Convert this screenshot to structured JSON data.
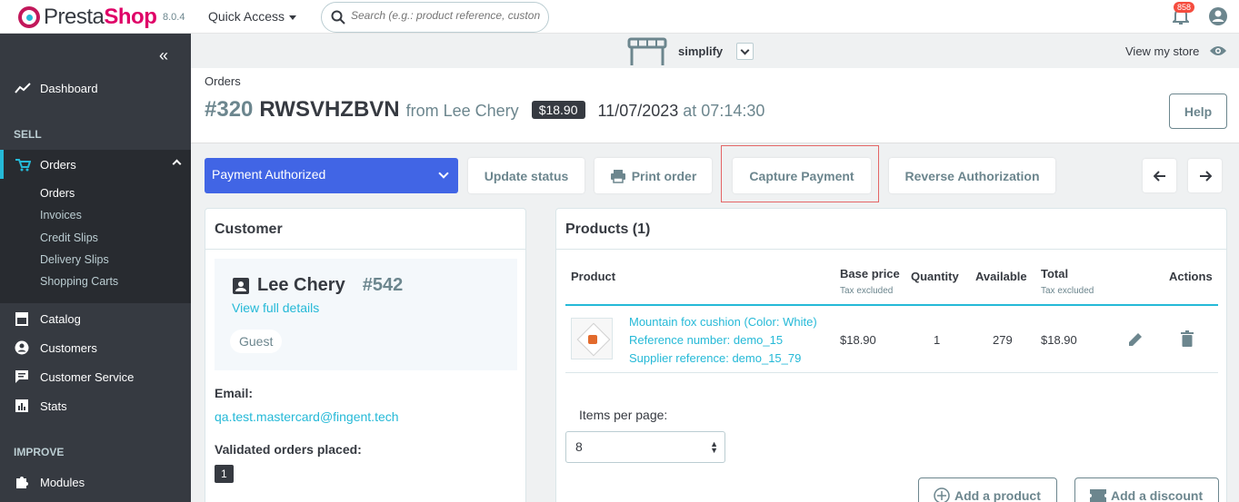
{
  "topbar": {
    "brand_pre": "Presta",
    "brand_shop": "Shop",
    "version": "8.0.4",
    "quick_access": "Quick Access",
    "search_placeholder": "Search (e.g.: product reference, custon",
    "notifications_count": "858"
  },
  "sidebar": {
    "items": [
      {
        "label": "Dashboard",
        "icon": "trending-up-icon"
      },
      {
        "label": "Orders",
        "icon": "cart-icon"
      },
      {
        "label": "Catalog",
        "icon": "store-icon"
      },
      {
        "label": "Customers",
        "icon": "user-circle-icon"
      },
      {
        "label": "Customer Service",
        "icon": "chat-icon"
      },
      {
        "label": "Stats",
        "icon": "bar-chart-icon"
      },
      {
        "label": "Modules",
        "icon": "puzzle-icon"
      }
    ],
    "sections": {
      "sell": "SELL",
      "improve": "IMPROVE"
    },
    "order_subitems": [
      "Orders",
      "Invoices",
      "Credit Slips",
      "Delivery Slips",
      "Shopping Carts"
    ]
  },
  "storebar": {
    "store_name": "simplify",
    "view_store": "View my store"
  },
  "header": {
    "breadcrumb": "Orders",
    "order_number": "#320",
    "order_reference": "RWSVHZBVN",
    "from_text": "from Lee Chery",
    "total_badge": "$18.90",
    "date": "11/07/2023",
    "time_text": "at 07:14:30",
    "help_label": "Help"
  },
  "actions": {
    "status": "Payment Authorized",
    "update_status": "Update status",
    "print_order": "Print order",
    "capture_payment": "Capture Payment",
    "reverse_authorization": "Reverse Authorization"
  },
  "customer": {
    "card_title": "Customer",
    "name": "Lee Chery",
    "id": "#542",
    "view_full_details": "View full details",
    "badge": "Guest",
    "email_label": "Email:",
    "email": "qa.test.mastercard@fingent.tech",
    "validated_label": "Validated orders placed:",
    "validated_count": "1"
  },
  "products": {
    "card_title": "Products (1)",
    "headers": {
      "product": "Product",
      "base_price": "Base price",
      "base_price_sub": "Tax excluded",
      "quantity": "Quantity",
      "available": "Available",
      "total": "Total",
      "total_sub": "Tax excluded",
      "actions": "Actions"
    },
    "rows": [
      {
        "name": "Mountain fox cushion (Color: White)",
        "reference": "Reference number: demo_15",
        "supplier_reference": "Supplier reference: demo_15_79",
        "base_price": "$18.90",
        "quantity": "1",
        "available": "279",
        "total": "$18.90"
      }
    ],
    "items_per_page_label": "Items per page:",
    "items_per_page_value": "8",
    "add_product": "Add a product",
    "add_discount": "Add a discount"
  },
  "colors": {
    "accent": "#25b9d7",
    "status_blue": "#4165e5",
    "sidebar_bg": "#363a41",
    "brand_pink": "#df0067",
    "highlight_red": "#e46565"
  }
}
